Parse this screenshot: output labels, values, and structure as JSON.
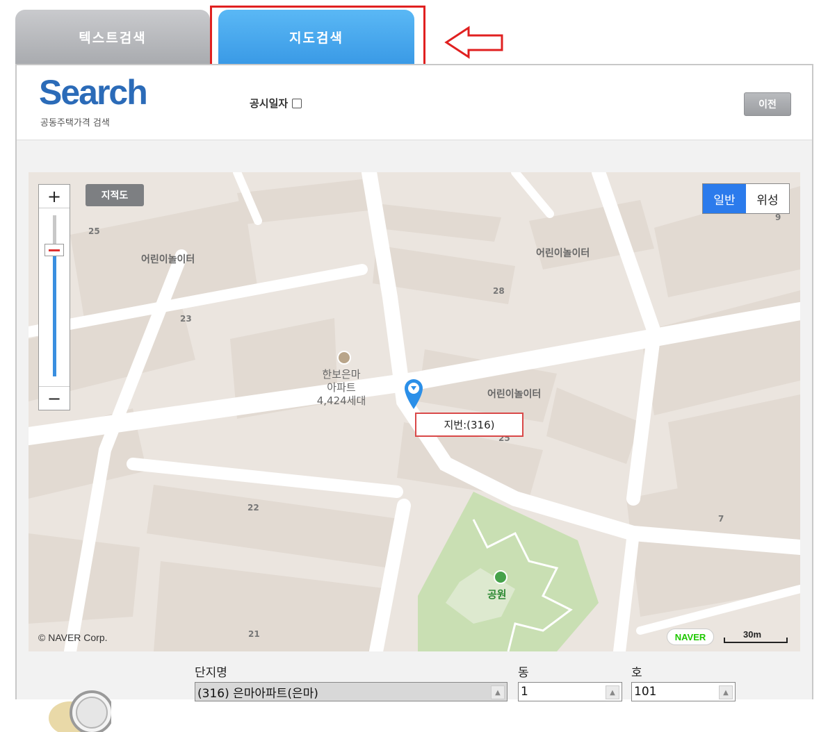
{
  "tabs": [
    {
      "label": "텍스트검색",
      "active": false
    },
    {
      "label": "지도검색",
      "active": true
    }
  ],
  "header": {
    "logo_word": "Search",
    "logo_sub": "공동주택가격 검색",
    "date_label": "공시일자",
    "prev_button": "이전"
  },
  "map": {
    "zoom_in": "+",
    "zoom_out": "−",
    "cadastral_button": "지적도",
    "map_types": {
      "normal": "일반",
      "satellite": "위성",
      "selected": "일반"
    },
    "labels": {
      "playground_left": "어린이놀이터",
      "playground_top_right": "어린이놀이터",
      "playground_center": "어린이놀이터",
      "apartment_name": "한보은마",
      "apartment_type": "아파트",
      "apartment_units": "4,424세대",
      "park": "공원"
    },
    "block_numbers": {
      "n25": "25",
      "n23": "23",
      "n28": "28",
      "n9": "9",
      "n22": "22",
      "n21": "21",
      "n7": "7",
      "n25b": "25"
    },
    "parcel_label": "지번:(316)",
    "copyright": "© NAVER Corp.",
    "naver_logo": "NAVER",
    "scale": "30m"
  },
  "search_fields": {
    "complex_label": "단지명",
    "complex_value": "(316) 은마아파트(은마)",
    "dong_label": "동",
    "dong_value": "1",
    "ho_label": "호",
    "ho_value": "101"
  },
  "colors": {
    "tab_active": "#4aa8ee",
    "tab_inactive": "#b5b7ba",
    "highlight": "#e02020",
    "logo": "#2b6bb8",
    "map_selected": "#2b7bec",
    "park": "#c9dfb3"
  }
}
